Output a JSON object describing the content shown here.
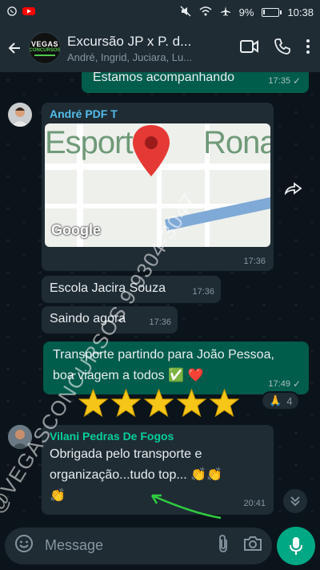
{
  "statusbar": {
    "battery": "9%",
    "time": "10:38",
    "battery_level": 0.09
  },
  "header": {
    "title": "Excursão JP x P. d...",
    "subtitle": "André, Ingrid, Juciara, Lu...",
    "avatar_line1": "VEGAS",
    "avatar_line2": "CONCURSOS"
  },
  "messages": {
    "m1": {
      "text": "Estamos acompanhando",
      "time": "17:35"
    },
    "m2": {
      "sender": "André PDF T",
      "map_label": "Esport",
      "map_label2": "Ronal",
      "map_brand": "Google",
      "time": "17:36"
    },
    "m3": {
      "text": "Escola Jacira Souza",
      "time": "17:36"
    },
    "m4": {
      "text": "Saindo agora",
      "time": "17:36"
    },
    "m5": {
      "line1": "Transporte partindo para João Pessoa,",
      "line2": "boa viagem a todos",
      "emojis": "✅ ❤️",
      "time": "17:49",
      "reaction_emoji": "🙏",
      "reaction_count": "4"
    },
    "m6": {
      "sender": "Vilani Pedras De Fogos",
      "line1": "Obrigada pelo transporte e",
      "line2": "organização...tudo top...",
      "emoji_end": "👏👏",
      "emoji_line3": "👏",
      "time": "20:41"
    }
  },
  "watermark": "@VEGASCONCURSOS 9 9304-3047",
  "input": {
    "placeholder": "Message"
  },
  "colors": {
    "outgoing": "#005c4b",
    "incoming": "#1f2c34",
    "accent": "#00a884",
    "sender_andre": "#53bdeb",
    "sender_vilani": "#06cf9c"
  }
}
